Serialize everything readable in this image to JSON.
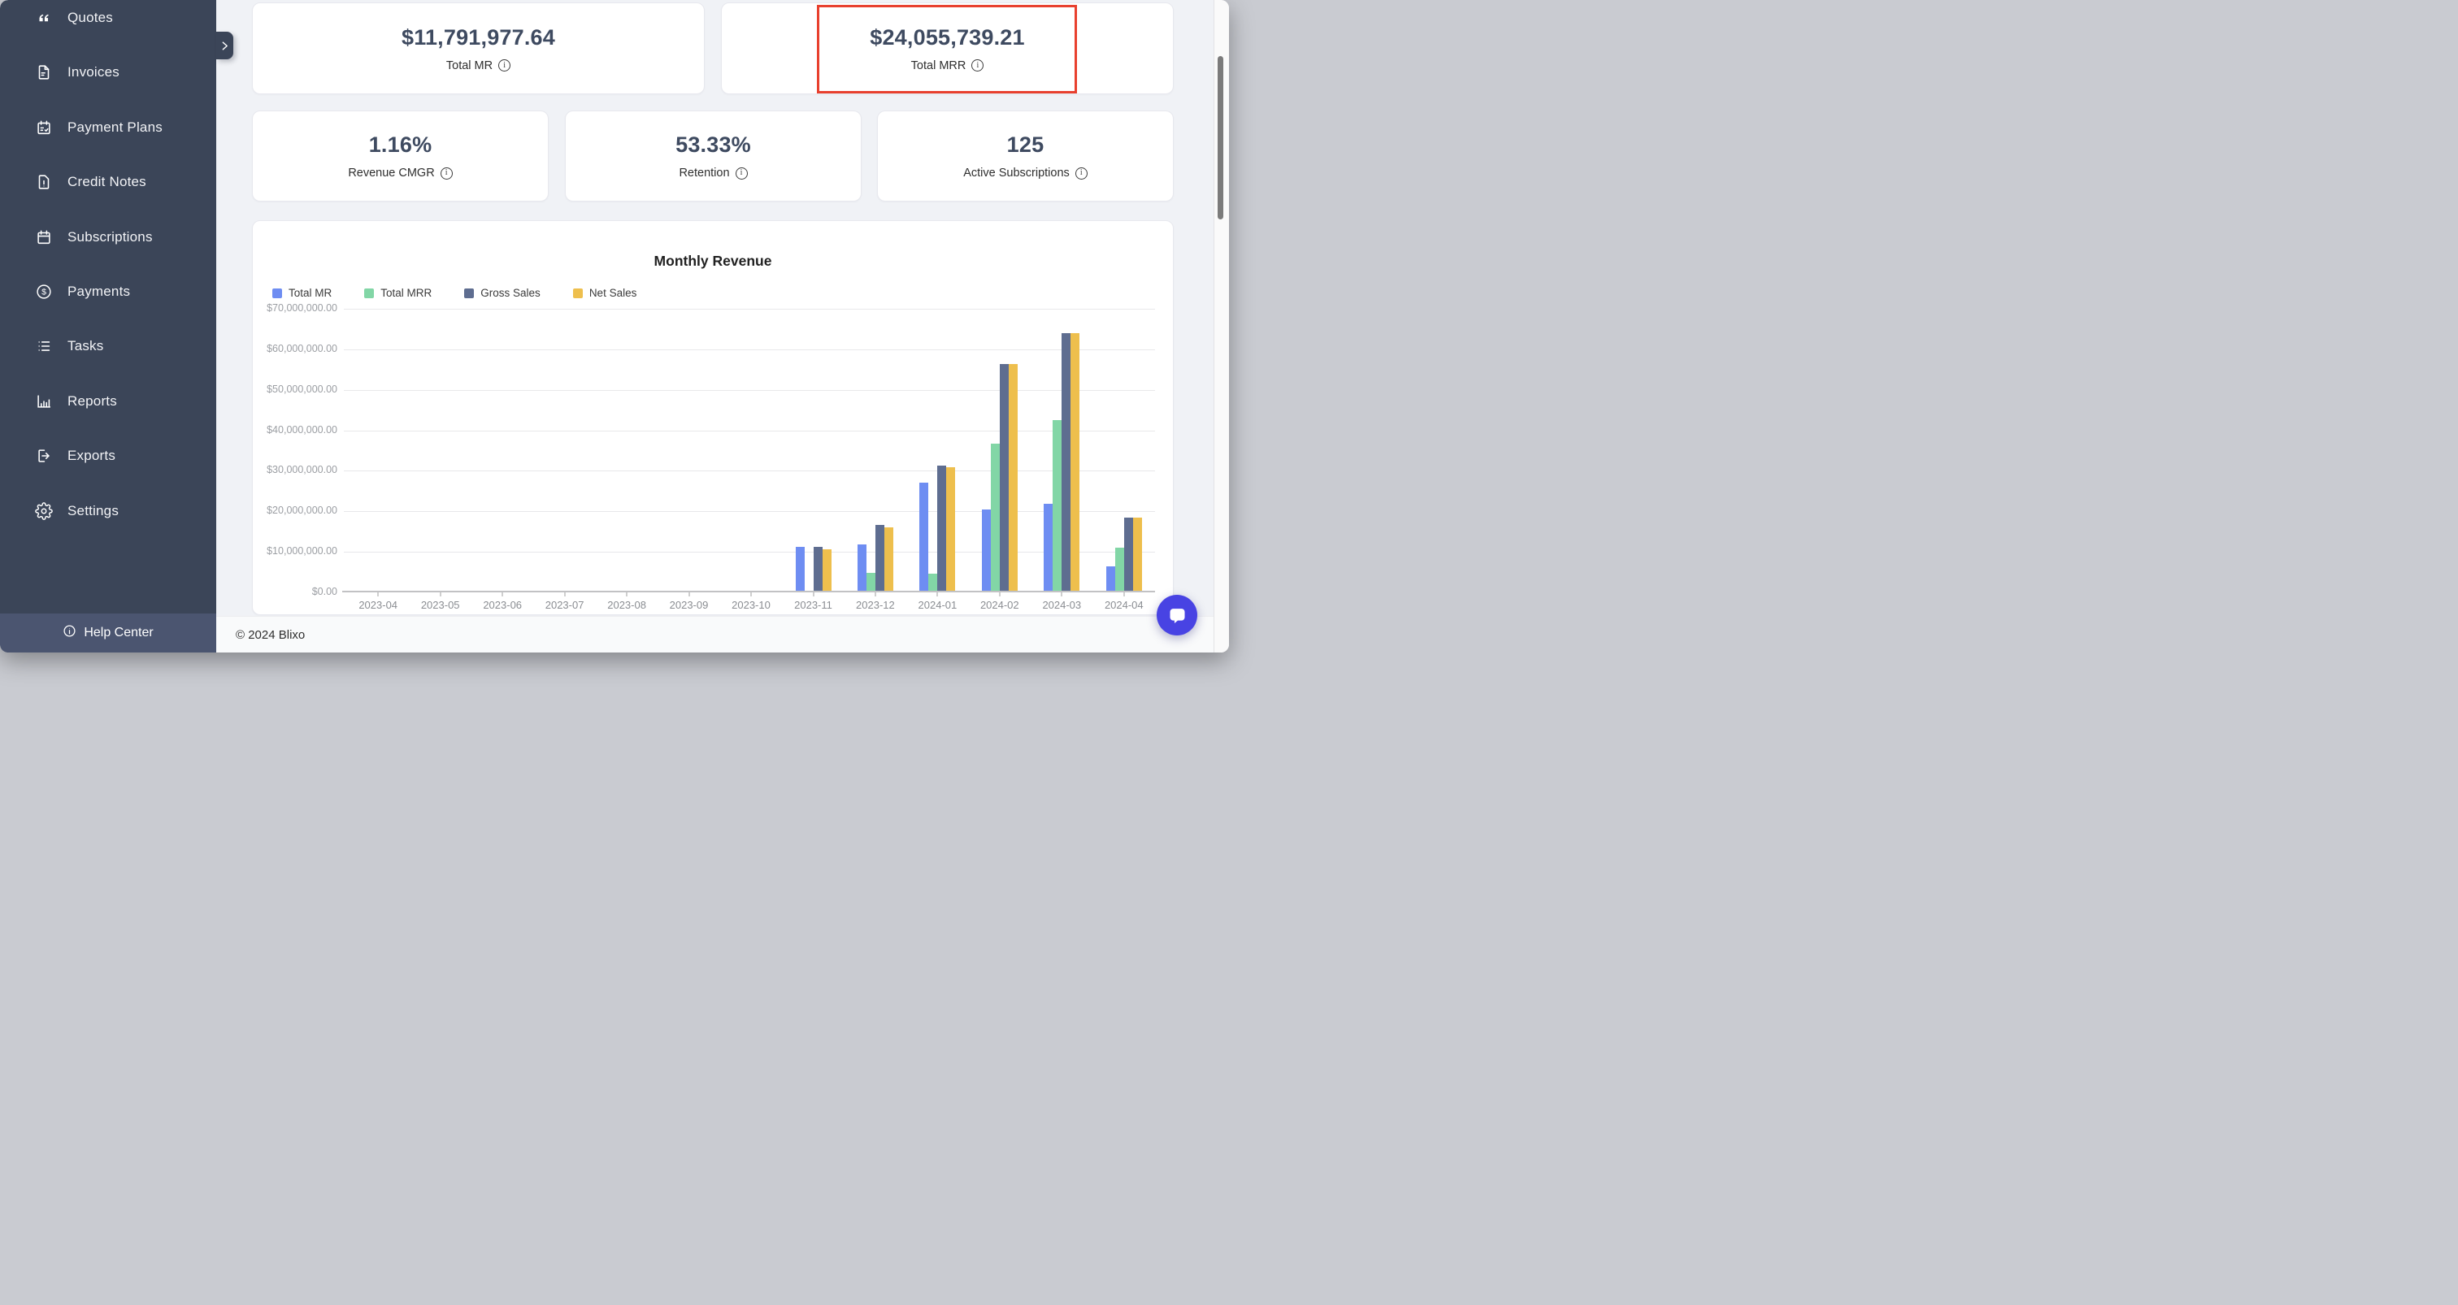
{
  "app": {
    "name": "Blixo"
  },
  "sidebar": {
    "items": [
      {
        "label": "Quotes",
        "icon": "quotes-icon"
      },
      {
        "label": "Invoices",
        "icon": "invoice-icon"
      },
      {
        "label": "Payment Plans",
        "icon": "payment-plans-icon"
      },
      {
        "label": "Credit Notes",
        "icon": "credit-note-icon"
      },
      {
        "label": "Subscriptions",
        "icon": "calendar-icon"
      },
      {
        "label": "Payments",
        "icon": "dollar-circle-icon"
      },
      {
        "label": "Tasks",
        "icon": "task-list-icon"
      },
      {
        "label": "Reports",
        "icon": "bar-chart-icon"
      },
      {
        "label": "Exports",
        "icon": "export-icon"
      },
      {
        "label": "Settings",
        "icon": "gear-icon"
      }
    ],
    "help_center": {
      "label": "Help Center",
      "icon": "info-icon"
    }
  },
  "stat_cards_row1": [
    {
      "value": "$11,791,977.64",
      "label": "Total MR",
      "highlighted": false
    },
    {
      "value": "$24,055,739.21",
      "label": "Total MRR",
      "highlighted": true
    }
  ],
  "stat_cards_row2": [
    {
      "value": "1.16%",
      "label": "Revenue CMGR"
    },
    {
      "value": "53.33%",
      "label": "Retention"
    },
    {
      "value": "125",
      "label": "Active Subscriptions"
    }
  ],
  "annotation": {
    "type": "red-highlight-box",
    "color": "#e8402e",
    "target": "Total MRR card"
  },
  "chart_data": {
    "type": "bar",
    "title": "Monthly Revenue",
    "grid": true,
    "legend_position": "top-left",
    "ylim": [
      0,
      70000000
    ],
    "y_tick_step": 10000000,
    "y_tick_labels": [
      "$70,000,000.00",
      "$60,000,000.00",
      "$50,000,000.00",
      "$40,000,000.00",
      "$30,000,000.00",
      "$20,000,000.00",
      "$10,000,000.00",
      "$0.00"
    ],
    "categories": [
      "2023-04",
      "2023-05",
      "2023-06",
      "2023-07",
      "2023-08",
      "2023-09",
      "2023-10",
      "2023-11",
      "2023-12",
      "2024-01",
      "2024-02",
      "2024-03",
      "2024-04"
    ],
    "series": [
      {
        "name": "Total MR",
        "color": "#6e8df2",
        "values": [
          0,
          0,
          0,
          0,
          0,
          0,
          0,
          10900000,
          11500000,
          26600000,
          20000000,
          21500000,
          6100000
        ]
      },
      {
        "name": "Total MRR",
        "color": "#82d6a6",
        "values": [
          0,
          0,
          0,
          0,
          0,
          0,
          0,
          0,
          4500000,
          4300000,
          36300000,
          42100000,
          10600000
        ]
      },
      {
        "name": "Gross Sales",
        "color": "#5e6d90",
        "values": [
          0,
          0,
          0,
          0,
          0,
          0,
          0,
          10900000,
          16300000,
          30800000,
          56000000,
          63500000,
          18100000
        ]
      },
      {
        "name": "Net Sales",
        "color": "#eebf4d",
        "values": [
          0,
          0,
          0,
          0,
          0,
          0,
          0,
          10300000,
          15600000,
          30400000,
          55900000,
          63500000,
          18100000
        ]
      }
    ]
  },
  "footer": {
    "copyright": "© 2024 Blixo"
  },
  "scrollbar": {
    "visible": true
  },
  "chat_widget": {
    "color": "#4843e3",
    "icon": "chat-bubble-icon"
  }
}
